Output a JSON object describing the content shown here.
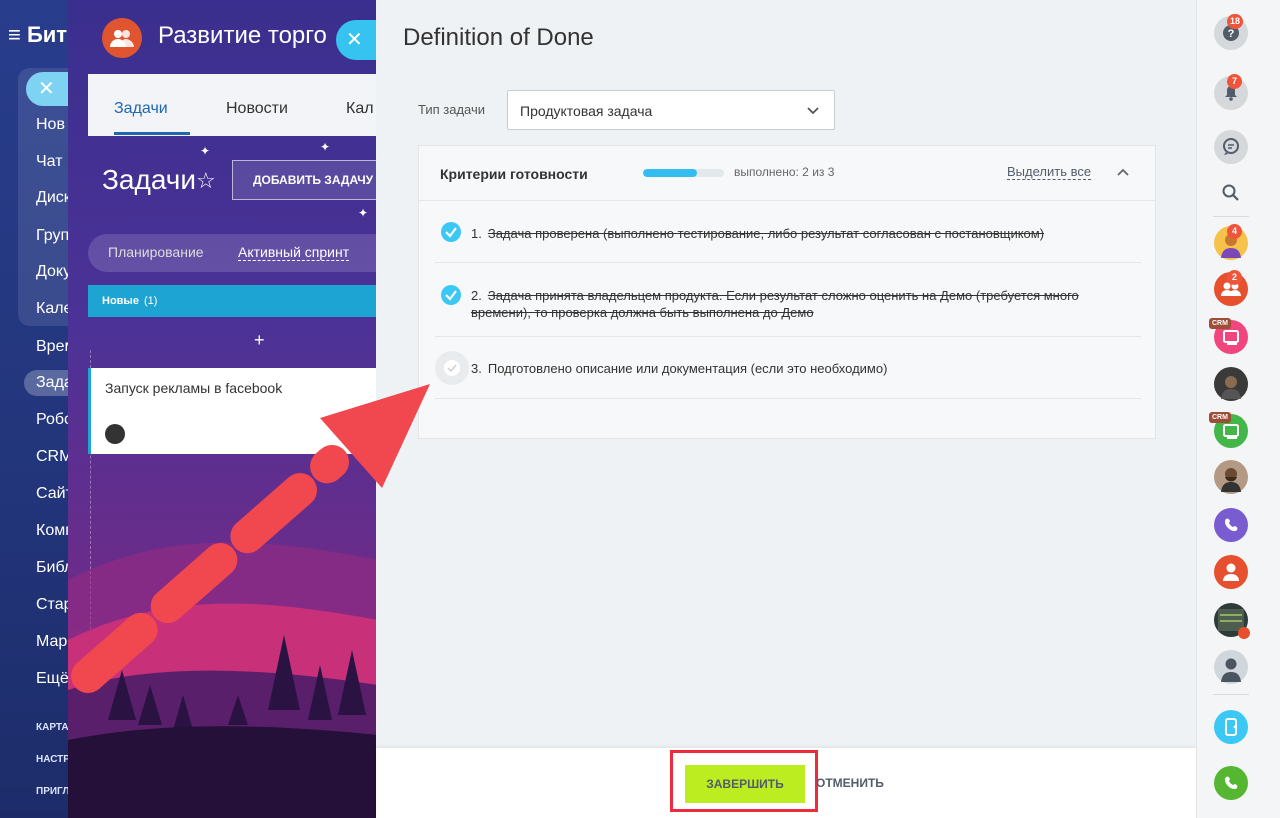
{
  "left_nav": {
    "logo": "≡ Бит",
    "close_glyph": "✕",
    "items": [
      "Нов",
      "Чат",
      "Диск",
      "Груп",
      "Доку",
      "Кале",
      "Врем",
      "Зада",
      "Робо",
      "CRM",
      "Сайт",
      "Комп",
      "Библ",
      "Стар",
      "Мар",
      "Ещё"
    ],
    "small": [
      "КАРТА",
      "НАСТР",
      "ПРИГЛ"
    ]
  },
  "group_panel": {
    "title": "Развитие торго",
    "close_glyph": "✕",
    "tabs": [
      "Задачи",
      "Новости",
      "Кал"
    ],
    "tasks_title": "Задачи",
    "add_task": "ДОБАВИТЬ ЗАДАЧУ",
    "sprint_tabs": [
      "Планирование",
      "Активный спринт"
    ],
    "column": {
      "name": "Новые",
      "count": "(1)"
    },
    "plus": "+",
    "card_title": "Запуск рекламы в facebook"
  },
  "dod": {
    "title": "Definition of Done",
    "type_label": "Тип задачи",
    "type_value": "Продуктовая задача",
    "criteria_title": "Критерии готовности",
    "progress": {
      "done": 2,
      "total": 3,
      "text": "выполнено: 2 из 3"
    },
    "select_all": "Выделить все",
    "items": [
      {
        "num": "1.",
        "text": "Задача проверена (выполнено тестирование, либо результат согласован с постановщиком)",
        "done": true
      },
      {
        "num": "2.",
        "text": "Задача принята владельцем продукта. Если результат сложно оценить на Демо (требуется много времени), то проверка должна быть выполнена до Демо",
        "done": true
      },
      {
        "num": "3.",
        "text": "Подготовлено описание или документация (если это необходимо)",
        "done": false
      }
    ],
    "finish_label": "ЗАВЕРШИТЬ",
    "cancel_label": "ОТМЕНИТЬ"
  },
  "right_bar": {
    "help_badge": "18",
    "notif_badge": "7",
    "user_badge": "4",
    "group_badge": "2",
    "crm_label": "CRM"
  },
  "colors": {
    "accent": "#3bc8f5",
    "finish_button": "#bbed21",
    "highlight": "#ec2b3c",
    "arrow": "#f0484e"
  }
}
